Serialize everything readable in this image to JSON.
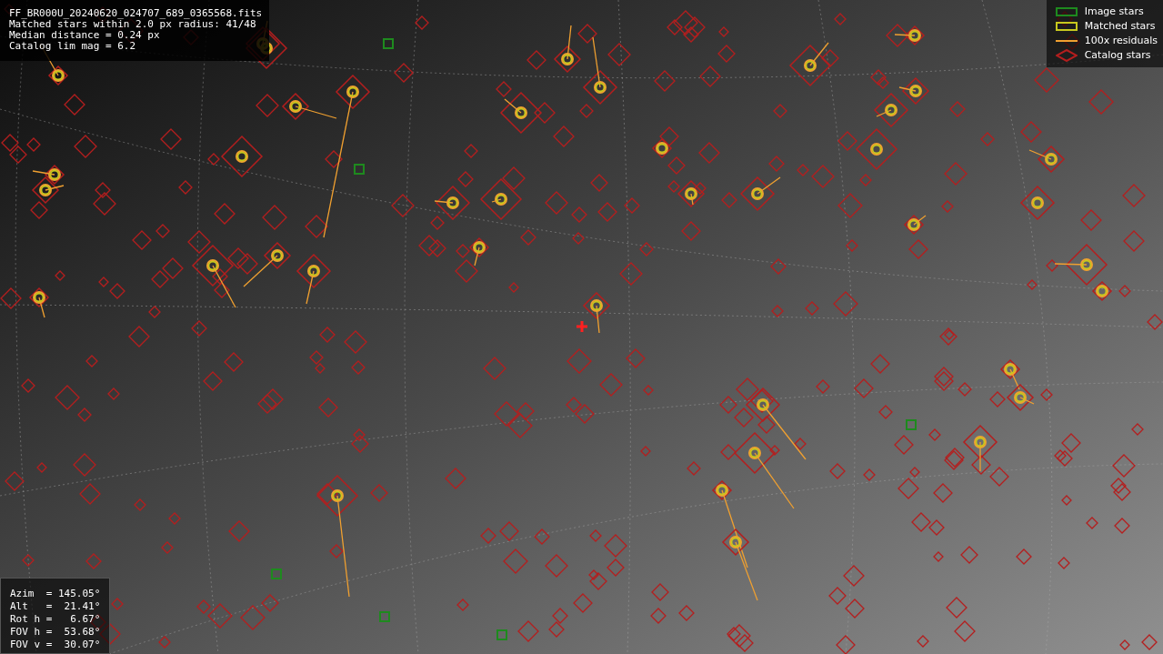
{
  "file_info": {
    "lines": [
      "FF_BR000U_20240620_024707_689_0365568.fits",
      "Matched stars within 2.0 px radius: 41/48",
      "Median distance = 0.24 px",
      "Catalog lim mag = 6.2"
    ]
  },
  "legend": [
    {
      "label": "Image stars",
      "kind": "box",
      "color": "#1e8a1e"
    },
    {
      "label": "Matched stars",
      "kind": "box",
      "color": "#c8c81e"
    },
    {
      "label": "100x residuals",
      "kind": "line",
      "color": "#f0a030"
    },
    {
      "label": "Catalog stars",
      "kind": "diamond",
      "color": "#b41e1e"
    }
  ],
  "pointing": {
    "lines": [
      "Azim  = 145.05°",
      "Alt   =  21.41°",
      "Rot h =   6.67°",
      "FOV h =  53.68°",
      "FOV v =  30.07°"
    ]
  }
}
